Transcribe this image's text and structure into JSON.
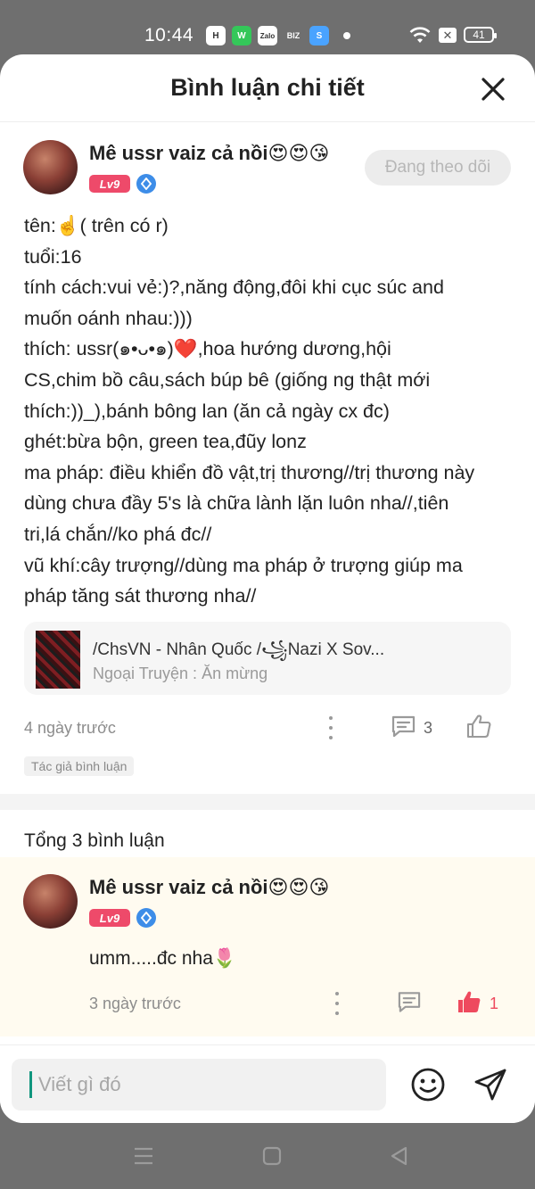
{
  "status_bar": {
    "time": "10:44",
    "apps": [
      "H",
      "W",
      "Zalo",
      "BIZ",
      "S"
    ],
    "battery": "41"
  },
  "header": {
    "title": "Bình luận chi tiết"
  },
  "main_comment": {
    "author": "Mê ussr vaiz cả nồi😍😍😘",
    "level": "Lv9",
    "follow_label": "Đang theo dõi",
    "lines": [
      "tên:☝️( trên có r)",
      "tuổi:16",
      "tính cách:vui vẻ:)?,năng động,đôi khi cục súc and",
      "muốn oánh nhau:)))",
      "thích: ussr(๑•ᴗ•๑)❤️,hoa hướng dương,hội",
      "CS,chim bồ câu,sách búp bê (giống ng thật mới",
      "thích:))_),bánh bông lan (ăn cả ngày cx đc)",
      "ghét:bừa bộn, green tea,đũy lonz",
      "ma pháp: điều khiển đồ vật,trị thương//trị thương này",
      "dùng chưa đầy 5's là chữa lành lặn luôn nha//,tiên",
      "tri,lá chắn//ko phá đc//",
      "vũ khí:cây trượng//dùng ma pháp ở trượng giúp ma",
      "pháp tăng sát thương nha//"
    ],
    "story": {
      "title": "/ChsVN - Nhân Quốc /꧁Nazi X Sov...",
      "subtitle": "Ngoại Truyện : Ăn mừng"
    },
    "time": "4 ngày trước",
    "reply_count": "3",
    "author_tag": "Tác giả bình luận"
  },
  "total_label": "Tổng 3 bình luận",
  "reply": {
    "author": "Mê ussr vaiz cả nồi😍😍😘",
    "level": "Lv9",
    "text": "umm.....đc nha🌷",
    "time": "3 ngày trước",
    "like_count": "1"
  },
  "input": {
    "placeholder": "Viết gì đó"
  },
  "colors": {
    "like_active": "#ee4a5e",
    "level_badge": "#ee4a6a",
    "accent_caret": "#11967e"
  }
}
